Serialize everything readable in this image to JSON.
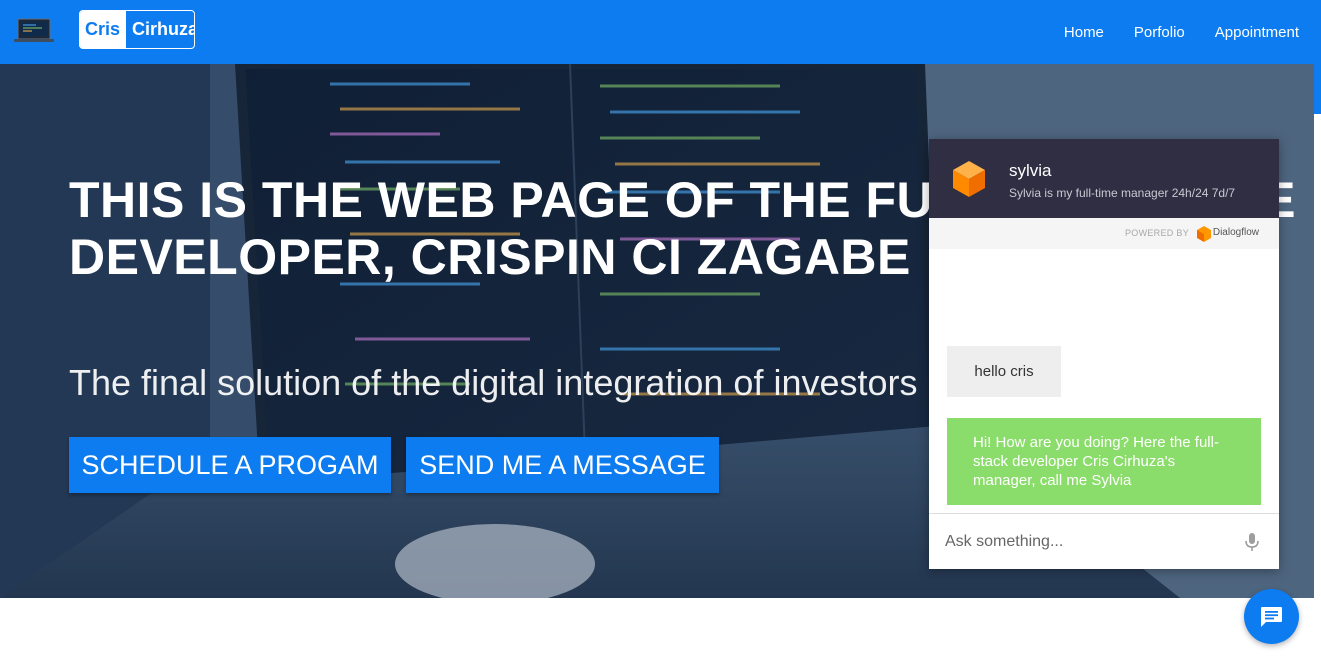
{
  "nav": {
    "brand_first": "Cris",
    "brand_second": "Cirhuza",
    "links": [
      "Home",
      "Porfolio",
      "Appointment"
    ],
    "logo_icon": "laptop-icon"
  },
  "hero": {
    "title": "THIS IS THE WEB PAGE OF THE FULL SOFTWARE DEVELOPER, CRISPIN CI ZAGABE",
    "subtitle": "The final solution of the digital integration of investors in Af",
    "buttons": {
      "schedule": "SCHEDULE A PROGAM",
      "message": "SEND ME A MESSAGE"
    }
  },
  "chat": {
    "bot_name": "sylvia",
    "bot_description": "Sylvia is my full-time manager 24h/24 7d/7",
    "powered_by": "POWERED BY",
    "provider": "Dialogflow",
    "messages": [
      {
        "from": "user",
        "text": "hello cris"
      },
      {
        "from": "bot",
        "text": "Hi! How are you doing? Here the full-stack developer Cris Cirhuza's manager, call me Sylvia"
      }
    ],
    "input_placeholder": "Ask something...",
    "mic_icon": "microphone-icon"
  },
  "fab": {
    "icon": "chat-bubble-icon"
  },
  "colors": {
    "primary": "#0d7cf0",
    "chat_header": "#2f2e42",
    "bot_bubble": "#8bdd6b",
    "user_bubble": "#eeeeee",
    "dialogflow_orange": "#ff9800"
  }
}
